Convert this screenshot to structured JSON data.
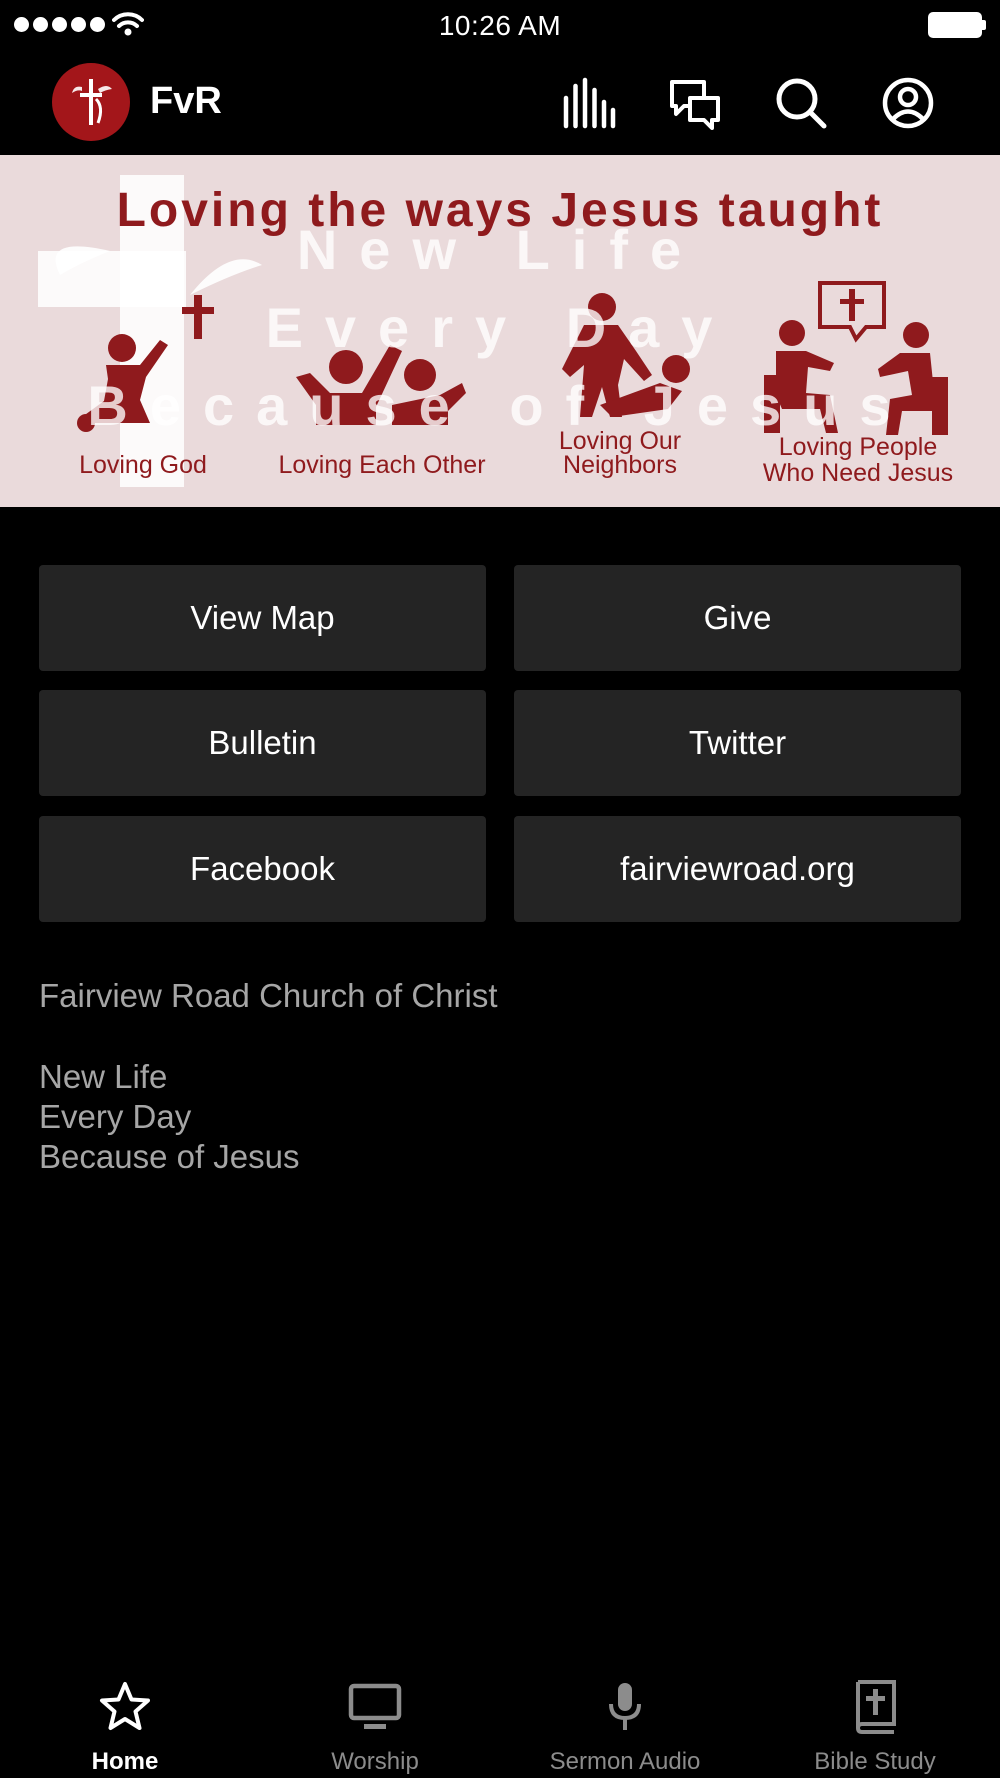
{
  "status_bar": {
    "time": "10:26 AM"
  },
  "header": {
    "title": "FvR",
    "icons": [
      "equalizer-icon",
      "chat-icon",
      "search-icon",
      "account-icon"
    ]
  },
  "banner": {
    "headline": "Loving the ways Jesus taught",
    "watermark": [
      "New Life",
      "Every Day",
      "Because of Jesus"
    ],
    "captions": {
      "loving_god": "Loving God",
      "loving_each_other": "Loving Each Other",
      "loving_neighbors_1": "Loving Our",
      "loving_neighbors_2": "Neighbors",
      "loving_people_1": "Loving People",
      "loving_people_2": "Who Need Jesus"
    },
    "accent_color": "#8f1a1d",
    "background_color": "#eadadb"
  },
  "buttons": {
    "view_map": "View Map",
    "give": "Give",
    "bulletin": "Bulletin",
    "twitter": "Twitter",
    "facebook": "Facebook",
    "website": "fairviewroad.org"
  },
  "info": {
    "church_name": "Fairview Road Church of Christ",
    "motto": [
      "New Life",
      "Every Day",
      "Because of Jesus"
    ]
  },
  "tabs": [
    {
      "label": "Home",
      "icon": "star-icon",
      "active": true
    },
    {
      "label": "Worship",
      "icon": "monitor-icon",
      "active": false
    },
    {
      "label": "Sermon Audio",
      "icon": "microphone-icon",
      "active": false
    },
    {
      "label": "Bible Study",
      "icon": "bible-icon",
      "active": false
    }
  ]
}
